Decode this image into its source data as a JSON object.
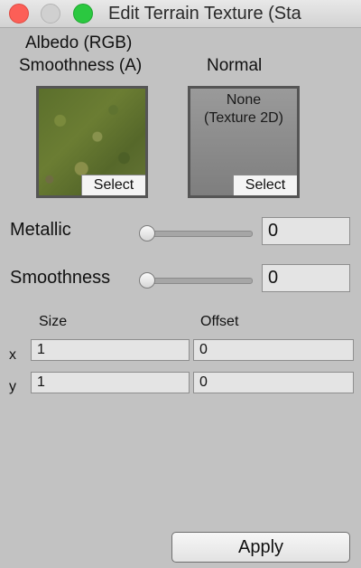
{
  "window": {
    "title": "Edit Terrain Texture (Sta"
  },
  "albedo": {
    "label_line1": "Albedo (RGB)",
    "label_line2": "Smoothness (A)",
    "select_label": "Select"
  },
  "normal": {
    "label": "Normal",
    "empty_line1": "None",
    "empty_line2": "(Texture 2D)",
    "select_label": "Select"
  },
  "metallic": {
    "label": "Metallic",
    "value": "0"
  },
  "smoothness": {
    "label": "Smoothness",
    "value": "0"
  },
  "tiling": {
    "size_header": "Size",
    "offset_header": "Offset",
    "x_label": "x",
    "y_label": "y",
    "size_x": "1",
    "size_y": "1",
    "offset_x": "0",
    "offset_y": "0"
  },
  "apply_label": "Apply"
}
